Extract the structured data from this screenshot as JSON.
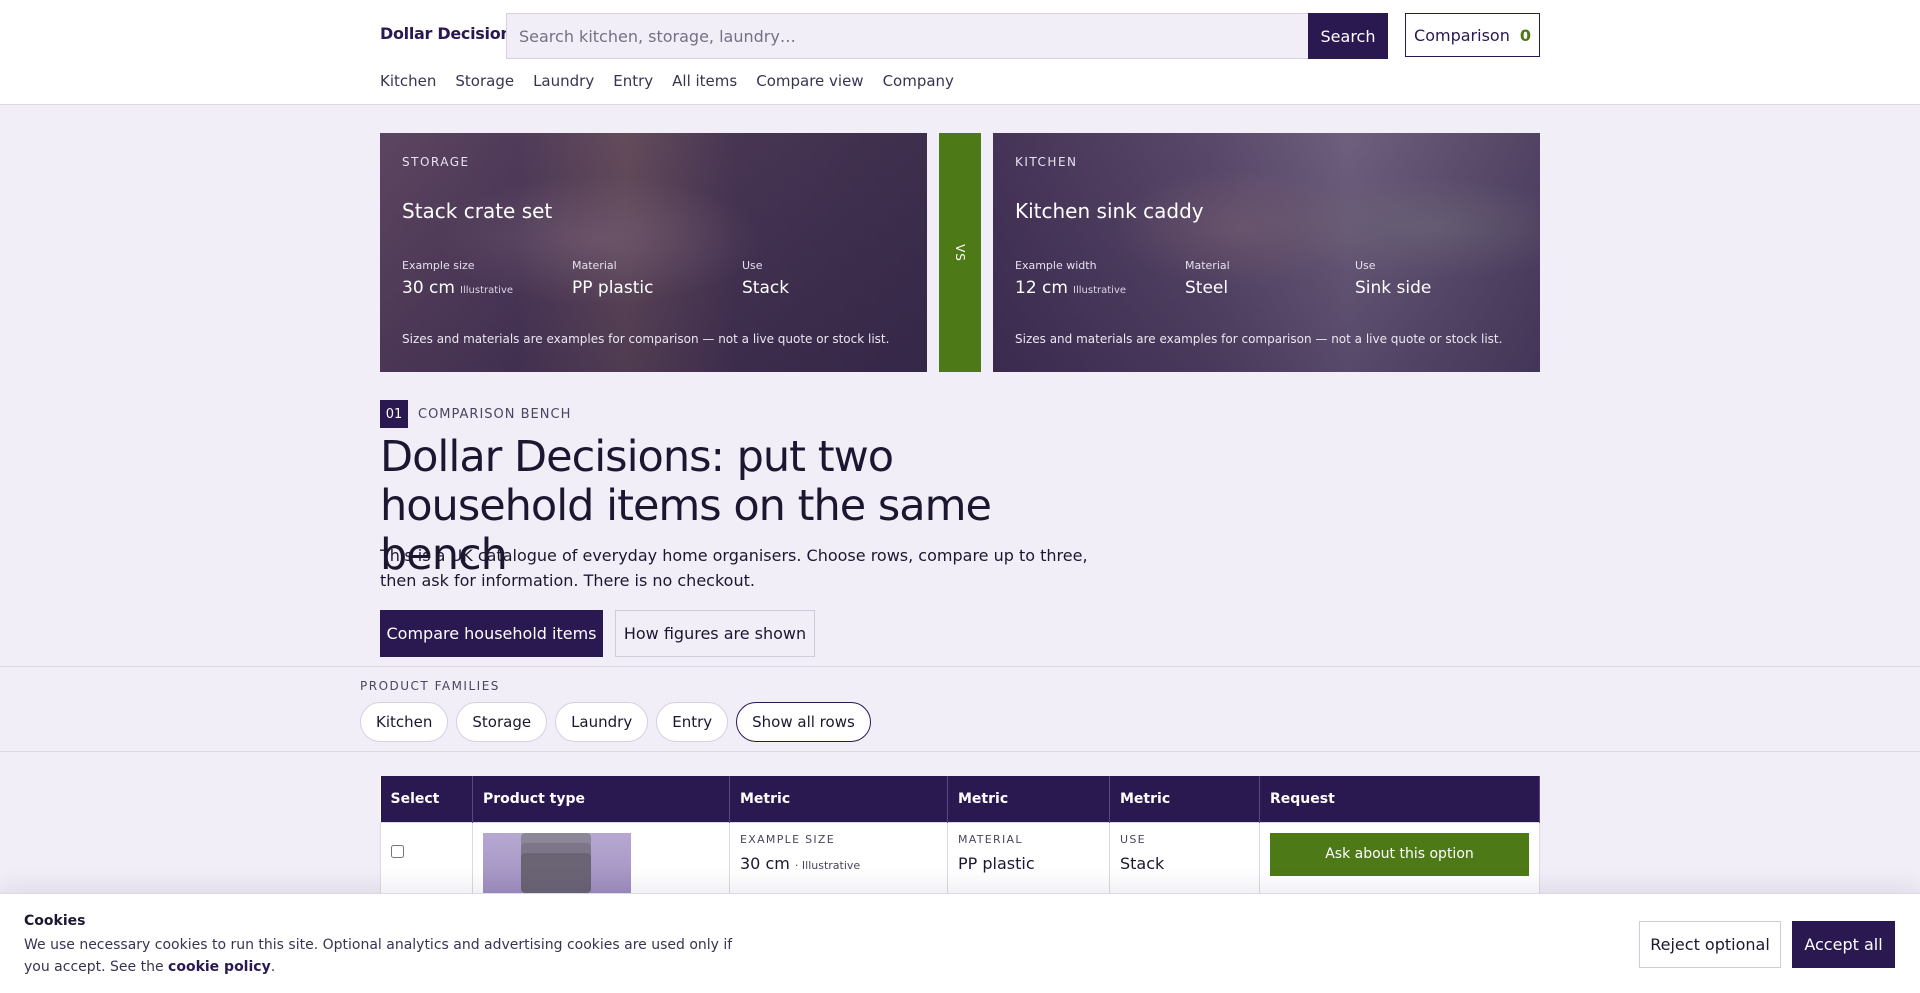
{
  "header": {
    "brand": "Dollar Decisions",
    "search_placeholder": "Search kitchen, storage, laundry…",
    "search_label": "Search",
    "comparison_label": "Comparison",
    "comparison_count": "0",
    "nav": [
      "Kitchen",
      "Storage",
      "Laundry",
      "Entry",
      "All items",
      "Compare view",
      "Company"
    ]
  },
  "hero": {
    "left": {
      "eyebrow": "STORAGE",
      "title": "Stack crate set",
      "specs": [
        {
          "label": "Example size",
          "value": "30 cm",
          "note": "Illustrative"
        },
        {
          "label": "Material",
          "value": "PP plastic",
          "note": ""
        },
        {
          "label": "Use",
          "value": "Stack",
          "note": ""
        }
      ],
      "note": "Sizes and materials are examples for comparison — not a live quote or stock list."
    },
    "vs": "VS",
    "right": {
      "eyebrow": "KITCHEN",
      "title": "Kitchen sink caddy",
      "specs": [
        {
          "label": "Example width",
          "value": "12 cm",
          "note": "Illustrative"
        },
        {
          "label": "Material",
          "value": "Steel",
          "note": ""
        },
        {
          "label": "Use",
          "value": "Sink side",
          "note": ""
        }
      ],
      "note": "Sizes and materials are examples for comparison — not a live quote or stock list."
    }
  },
  "intro": {
    "tag_number": "01",
    "tag_label": "COMPARISON BENCH",
    "title": "Dollar Decisions: put two household items on the same bench",
    "text": "This is a UK catalogue of everyday home organisers. Choose rows, compare up to three, then ask for information. There is no checkout.",
    "primary_button": "Compare household items",
    "secondary_button": "How figures are shown"
  },
  "families": {
    "label": "PRODUCT FAMILIES",
    "chips": [
      "Kitchen",
      "Storage",
      "Laundry",
      "Entry",
      "Show all rows"
    ]
  },
  "table": {
    "headers": [
      "Select",
      "Product type",
      "Metric",
      "Metric",
      "Metric",
      "Request"
    ],
    "rows": [
      {
        "metric1_label": "EXAMPLE SIZE",
        "metric1_value": "30 cm",
        "metric1_note": "· Illustrative",
        "metric2_label": "MATERIAL",
        "metric2_value": "PP plastic",
        "metric3_label": "USE",
        "metric3_value": "Stack",
        "request_label": "Ask about this option"
      }
    ]
  },
  "cookie": {
    "title": "Cookies",
    "text": "We use necessary cookies to run this site. Optional analytics and advertising cookies are used only if you accept. See the",
    "link": "cookie policy",
    "text_end": ".",
    "reject": "Reject optional",
    "accept": "Accept all"
  }
}
